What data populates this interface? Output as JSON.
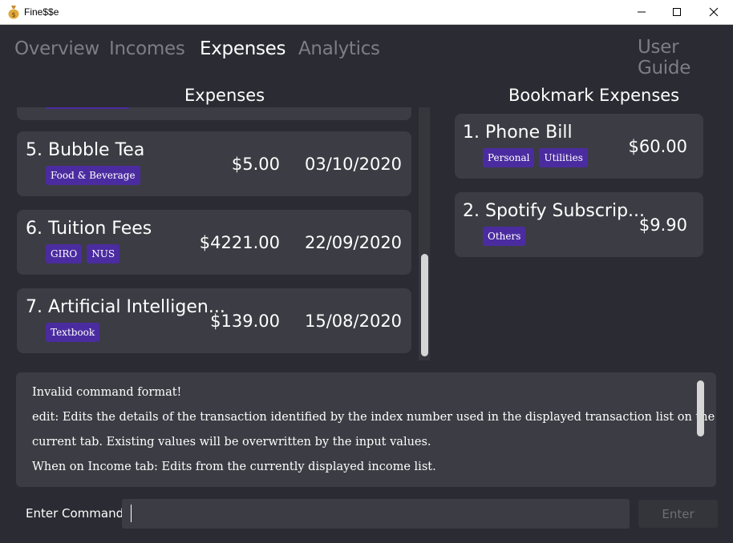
{
  "window": {
    "title": "Fine$$e"
  },
  "tabs": [
    {
      "label": "Overview",
      "active": false
    },
    {
      "label": "Incomes",
      "active": false
    },
    {
      "label": "Expenses",
      "active": true
    },
    {
      "label": "Analytics",
      "active": false
    }
  ],
  "user_guide_label": "User Guide",
  "expenses_panel": {
    "title": "Expenses",
    "items": [
      {
        "title": "5. Bubble Tea",
        "tags": [
          "Food & Beverage"
        ],
        "amount": "$5.00",
        "date": "03/10/2020"
      },
      {
        "title": "6. Tuition Fees",
        "tags": [
          "GIRO",
          "NUS"
        ],
        "amount": "$4221.00",
        "date": "22/09/2020"
      },
      {
        "title": "7. Artificial Intelligen...",
        "tags": [
          "Textbook"
        ],
        "amount": "$139.00",
        "date": "15/08/2020"
      }
    ]
  },
  "bookmark_panel": {
    "title": "Bookmark Expenses",
    "items": [
      {
        "title": "1. Phone Bill",
        "tags": [
          "Personal",
          "Utilities"
        ],
        "amount": "$60.00"
      },
      {
        "title": "2. Spotify Subscrip...",
        "tags": [
          "Others"
        ],
        "amount": "$9.90"
      }
    ]
  },
  "result_display": {
    "lines": [
      "Invalid command format!",
      "edit: Edits the details of the transaction identified by the index number used in the displayed transaction list on the",
      "current tab. Existing values will be overwritten by the input values.",
      "When on Income tab: Edits from the currently displayed income list."
    ]
  },
  "command_box": {
    "label": "Enter Command:",
    "value": "",
    "enter_label": "Enter"
  },
  "colors": {
    "background": "#2b2b33",
    "card": "#3c3c44",
    "tag": "#4b2ca0",
    "tab_inactive": "#7d7d84",
    "tab_active": "#ffffff"
  },
  "icons": {
    "app": "money-bag-icon",
    "minimize": "minimize-icon",
    "maximize": "maximize-icon",
    "close": "close-icon"
  }
}
